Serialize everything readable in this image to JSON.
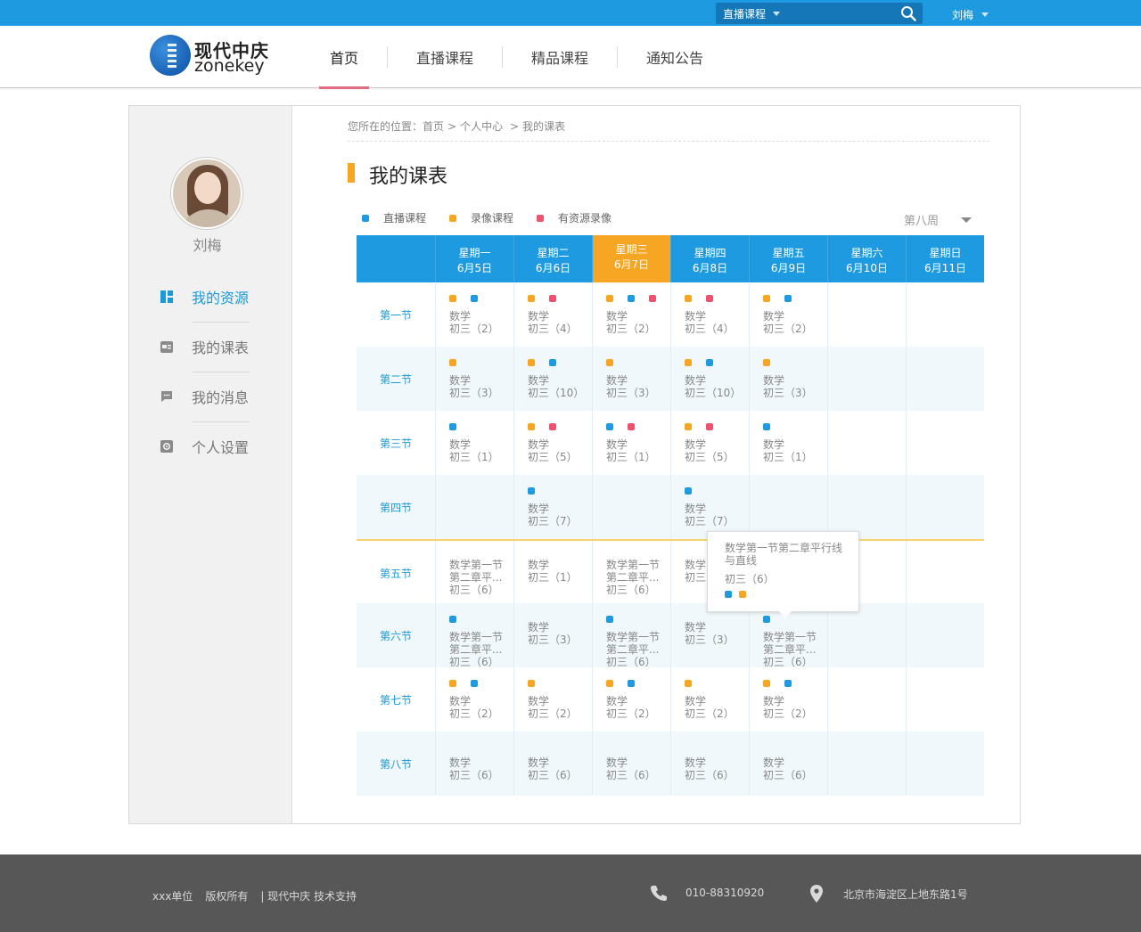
{
  "colors": {
    "blue": "#1e9be0",
    "orange": "#f6a623",
    "red": "#f0526e"
  },
  "topbar": {
    "search_category": "直播课程",
    "user": "刘梅"
  },
  "header": {
    "logo_cn": "现代中庆",
    "logo_en": "zonekey",
    "nav": [
      {
        "label": "首页"
      },
      {
        "label": "直播课程"
      },
      {
        "label": "精品课程"
      },
      {
        "label": "通知公告"
      }
    ]
  },
  "sidebar": {
    "user_name": "刘梅",
    "menu": [
      {
        "label": "我的资源",
        "icon": "dashboard-icon"
      },
      {
        "label": "我的课表",
        "icon": "calendar-icon"
      },
      {
        "label": "我的消息",
        "icon": "message-icon"
      },
      {
        "label": "个人设置",
        "icon": "settings-icon"
      }
    ]
  },
  "breadcrumb": {
    "prefix": "您所在的位置：",
    "items": [
      "首页",
      ">",
      "个人中心",
      ">",
      "我的课表"
    ]
  },
  "page_title": "我的课表",
  "legend": [
    {
      "label": "直播课程",
      "color": "blue"
    },
    {
      "label": "录像课程",
      "color": "orange"
    },
    {
      "label": "有资源录像",
      "color": "red"
    }
  ],
  "week_selector": "第八周",
  "schedule": {
    "days": [
      {
        "weekday": "星期一",
        "date": "6月5日"
      },
      {
        "weekday": "星期二",
        "date": "6月6日"
      },
      {
        "weekday": "星期三",
        "date": "6月7日",
        "today": true
      },
      {
        "weekday": "星期四",
        "date": "6月8日"
      },
      {
        "weekday": "星期五",
        "date": "6月9日"
      },
      {
        "weekday": "星期六",
        "date": "6月10日"
      },
      {
        "weekday": "星期日",
        "date": "6月11日"
      }
    ],
    "periods": [
      {
        "label": "第一节",
        "cells": [
          {
            "dots": [
              "orange",
              "blue"
            ],
            "text": "数学\n初三（2）"
          },
          {
            "dots": [
              "orange",
              "red"
            ],
            "text": "数学\n初三（4）"
          },
          {
            "dots": [
              "orange",
              "blue",
              "red"
            ],
            "text": "数学\n初三（2）"
          },
          {
            "dots": [
              "orange",
              "red"
            ],
            "text": "数学\n初三（4）"
          },
          {
            "dots": [
              "orange",
              "blue"
            ],
            "text": "数学\n初三（2）"
          },
          null,
          null
        ]
      },
      {
        "label": "第二节",
        "cells": [
          {
            "dots": [
              "orange"
            ],
            "text": "数学\n初三（3）"
          },
          {
            "dots": [
              "orange",
              "blue"
            ],
            "text": "数学\n初三（10）"
          },
          {
            "dots": [
              "orange"
            ],
            "text": "数学\n初三（3）"
          },
          {
            "dots": [
              "orange",
              "blue"
            ],
            "text": "数学\n初三（10）"
          },
          {
            "dots": [
              "orange"
            ],
            "text": "数学\n初三（3）"
          },
          null,
          null
        ]
      },
      {
        "label": "第三节",
        "cells": [
          {
            "dots": [
              "blue"
            ],
            "text": "数学\n初三（1）"
          },
          {
            "dots": [
              "orange",
              "red"
            ],
            "text": "数学\n初三（5）"
          },
          {
            "dots": [
              "blue",
              "red"
            ],
            "text": "数学\n初三（1）"
          },
          {
            "dots": [
              "orange",
              "red"
            ],
            "text": "数学\n初三（5）"
          },
          {
            "dots": [
              "blue"
            ],
            "text": "数学\n初三（1）"
          },
          null,
          null
        ]
      },
      {
        "label": "第四节",
        "cells": [
          null,
          {
            "dots": [
              "blue"
            ],
            "text": "数学\n初三（7）"
          },
          null,
          {
            "dots": [
              "blue"
            ],
            "text": "数学\n初三（7）"
          },
          null,
          null,
          null
        ]
      },
      {
        "label": "第五节",
        "cells": [
          {
            "dots": [],
            "text": "数学第一节\n第二章平...\n初三（6）"
          },
          {
            "dots": [],
            "text": "数学\n初三（1）"
          },
          {
            "dots": [],
            "text": "数学第一节\n第二章平...\n初三（6）"
          },
          {
            "dots": [],
            "text": "数学\n初三"
          },
          null,
          null,
          null
        ]
      },
      {
        "label": "第六节",
        "cells": [
          {
            "dots": [
              "blue"
            ],
            "text": "数学第一节\n第二章平...\n初三（6）"
          },
          {
            "dots": [],
            "text": "数学\n初三（3）"
          },
          {
            "dots": [
              "blue"
            ],
            "text": "数学第一节\n第二章平...\n初三（6）"
          },
          {
            "dots": [],
            "text": "数学\n初三（3）"
          },
          {
            "dots": [
              "blue"
            ],
            "text": "数学第一节\n第二章平...\n初三（6）"
          },
          null,
          null
        ]
      },
      {
        "label": "第七节",
        "cells": [
          {
            "dots": [
              "orange",
              "blue"
            ],
            "text": "数学\n初三（2）"
          },
          {
            "dots": [
              "orange"
            ],
            "text": "数学\n初三（2）"
          },
          {
            "dots": [
              "orange",
              "blue"
            ],
            "text": "数学\n初三（2）"
          },
          {
            "dots": [
              "orange"
            ],
            "text": "数学\n初三（2）"
          },
          {
            "dots": [
              "orange",
              "blue"
            ],
            "text": "数学\n初三（2）"
          },
          null,
          null
        ]
      },
      {
        "label": "第八节",
        "cells": [
          {
            "dots": [],
            "text": "数学\n初三（6）"
          },
          {
            "dots": [],
            "text": "数学\n初三（6）"
          },
          {
            "dots": [],
            "text": "数学\n初三（6）"
          },
          {
            "dots": [],
            "text": "数学\n初三（6）"
          },
          {
            "dots": [],
            "text": "数学\n初三（6）"
          },
          null,
          null
        ]
      }
    ]
  },
  "tooltip": {
    "title": "数学第一节第二章平行线与直线",
    "class": "初三（6）",
    "dots": [
      "blue",
      "orange"
    ]
  },
  "footer": {
    "unit": "xxx单位",
    "rights": "版权所有",
    "support": "| 现代中庆 技术支持",
    "phone": "010-88310920",
    "address": "北京市海淀区上地东路1号"
  }
}
